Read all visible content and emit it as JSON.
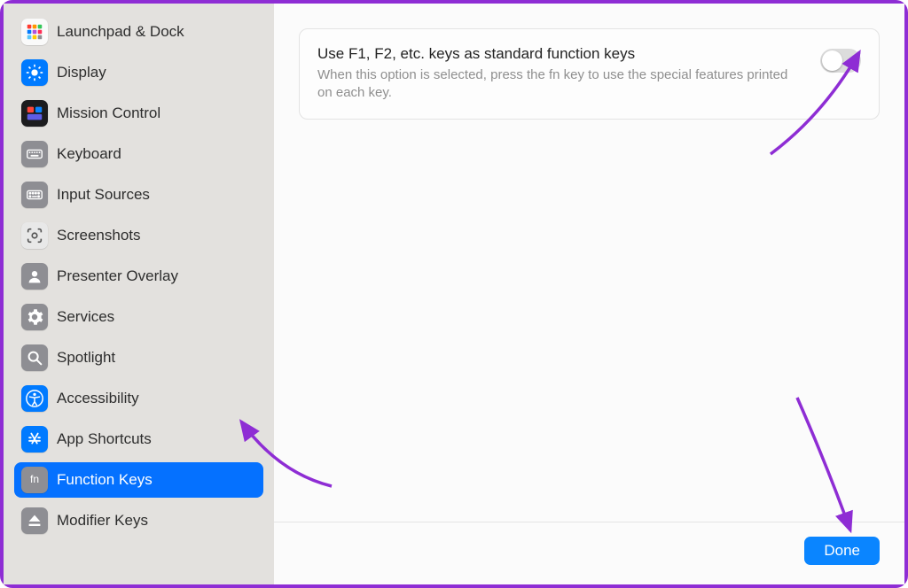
{
  "sidebar": {
    "items": [
      {
        "label": "Launchpad & Dock",
        "icon": "launchpad"
      },
      {
        "label": "Display",
        "icon": "display"
      },
      {
        "label": "Mission Control",
        "icon": "mission-control"
      },
      {
        "label": "Keyboard",
        "icon": "keyboard"
      },
      {
        "label": "Input Sources",
        "icon": "input-sources"
      },
      {
        "label": "Screenshots",
        "icon": "screenshot"
      },
      {
        "label": "Presenter Overlay",
        "icon": "presenter"
      },
      {
        "label": "Services",
        "icon": "services"
      },
      {
        "label": "Spotlight",
        "icon": "spotlight"
      },
      {
        "label": "Accessibility",
        "icon": "accessibility"
      },
      {
        "label": "App Shortcuts",
        "icon": "app-shortcuts"
      },
      {
        "label": "Function Keys",
        "icon": "function-keys"
      },
      {
        "label": "Modifier Keys",
        "icon": "modifier-keys"
      }
    ]
  },
  "setting": {
    "title": "Use F1, F2, etc. keys as standard function keys",
    "description": "When this option is selected, press the fn key to use the special features printed on each key.",
    "enabled": false
  },
  "footer": {
    "done_label": "Done"
  },
  "colors": {
    "accent": "#0571ff",
    "annotation": "#8e2dd4"
  }
}
